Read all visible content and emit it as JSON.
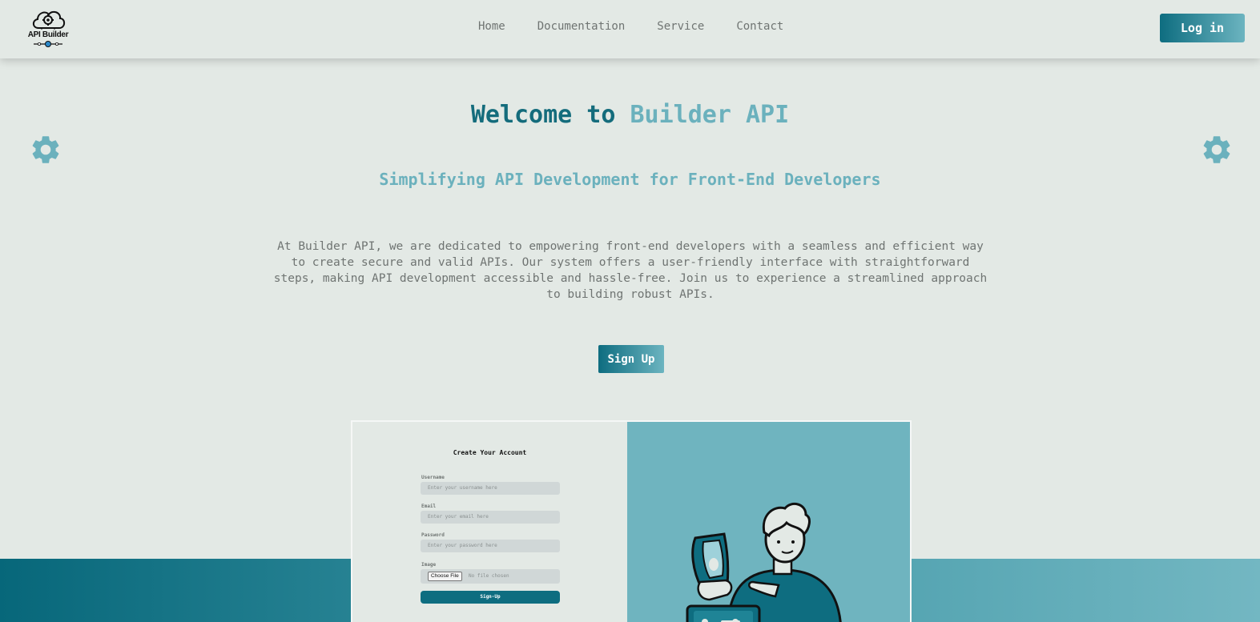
{
  "navbar": {
    "logo_text": "API Builder",
    "links": [
      "Home",
      "Documentation",
      "Service",
      "Contact"
    ],
    "login_label": "Log in"
  },
  "hero": {
    "title_part1": "Welcome to ",
    "title_part2": "Builder API",
    "subtitle": "Simplifying API Development for Front-End Developers",
    "description": "At Builder API, we are dedicated to empowering front-end developers with a seamless and efficient way to create secure and valid APIs. Our system offers a user-friendly interface with straightforward steps, making API development accessible and hassle-free. Join us to experience a streamlined approach to building robust APIs.",
    "signup_label": "Sign Up"
  },
  "preview": {
    "form_title": "Create Your Account",
    "fields": [
      {
        "label": "Username",
        "placeholder": "Enter your username here"
      },
      {
        "label": "Email",
        "placeholder": "Enter your email here"
      },
      {
        "label": "Password",
        "placeholder": "Enter your password here"
      }
    ],
    "image_label": "Image",
    "choose_file": "Choose File",
    "no_file": "No file chosen",
    "submit_label": "Sign-Up"
  },
  "colors": {
    "primary": "#0e6d80",
    "accent": "#6bb1bd",
    "background": "#e3e9e5",
    "muted_text": "#6f7472"
  },
  "icons": [
    "cloud-gear-logo-icon",
    "gear-icon"
  ]
}
